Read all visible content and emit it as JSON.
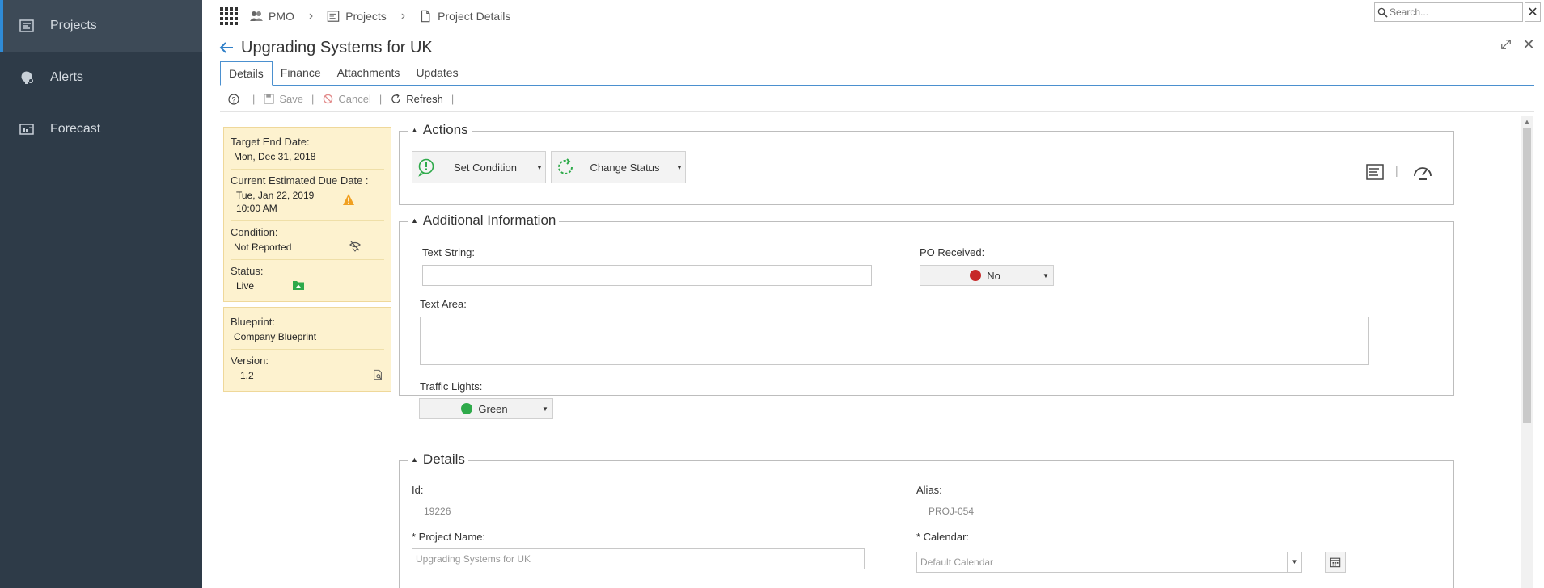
{
  "sidebar": {
    "items": [
      {
        "label": "Projects",
        "icon": "projects-icon"
      },
      {
        "label": "Alerts",
        "icon": "alerts-icon"
      },
      {
        "label": "Forecast",
        "icon": "forecast-icon"
      }
    ]
  },
  "topbar": {
    "breadcrumbs": [
      "PMO",
      "Projects",
      "Project Details"
    ],
    "search_placeholder": "Search..."
  },
  "page": {
    "title": "Upgrading Systems for UK"
  },
  "tabs": [
    "Details",
    "Finance",
    "Attachments",
    "Updates"
  ],
  "toolbar": {
    "save_label": "Save",
    "cancel_label": "Cancel",
    "refresh_label": "Refresh"
  },
  "summary": {
    "target_end_label": "Target End Date:",
    "target_end_value": "Mon, Dec 31, 2018",
    "current_due_label": "Current Estimated Due Date :",
    "current_due_value_line1": "Tue, Jan 22, 2019",
    "current_due_value_line2": "10:00 AM",
    "condition_label": "Condition:",
    "condition_value": "Not Reported",
    "status_label": "Status:",
    "status_value": "Live",
    "blueprint_label": "Blueprint:",
    "blueprint_value": "Company Blueprint",
    "version_label": "Version:",
    "version_value": "1.2"
  },
  "actions": {
    "title": "Actions",
    "set_condition": "Set Condition",
    "change_status": "Change Status"
  },
  "additional": {
    "title": "Additional Information",
    "text_string_label": "Text String:",
    "text_string_value": "",
    "po_received_label": "PO Received:",
    "po_received_value": "No",
    "text_area_label": "Text Area:",
    "traffic_lights_label": "Traffic Lights:",
    "traffic_lights_value": "Green"
  },
  "details": {
    "title": "Details",
    "id_label": "Id:",
    "id_value": "19226",
    "alias_label": "Alias:",
    "alias_value": "PROJ-054",
    "project_name_label": "* Project Name:",
    "project_name_value": "Upgrading Systems for UK",
    "calendar_label": "* Calendar:",
    "calendar_value": "Default Calendar"
  },
  "colors": {
    "sidebar_bg": "#2e3b48",
    "accent": "#2f8bd6",
    "summary_bg": "#fdf2cf",
    "status_green": "#2eaa4a",
    "po_red": "#c62828",
    "warning": "#f0a020"
  }
}
